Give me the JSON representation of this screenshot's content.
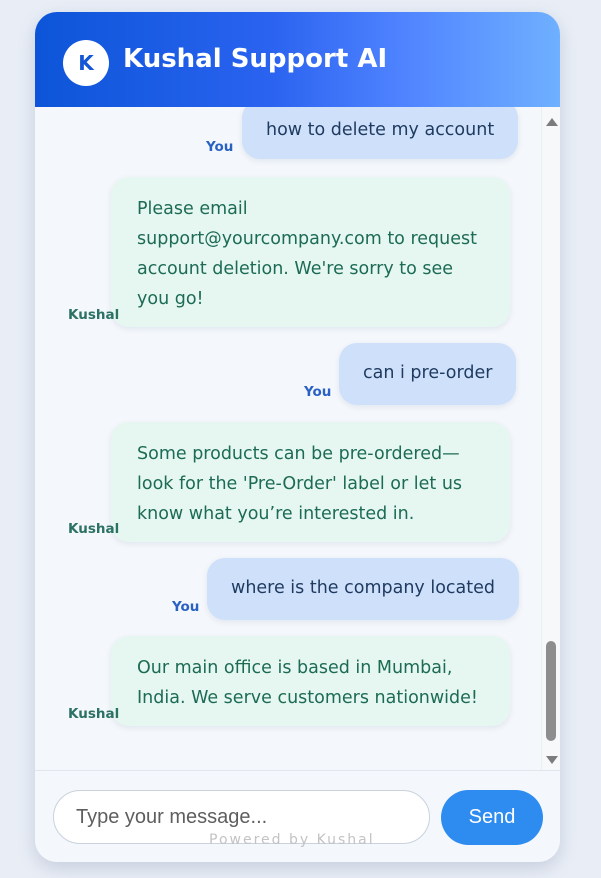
{
  "header": {
    "avatar_letter": "K",
    "title": "Kushal Support AI"
  },
  "messages": [
    {
      "role": "user",
      "sender": "You",
      "text": "how to delete my account"
    },
    {
      "role": "bot",
      "sender": "Kushal",
      "text": "Please email support@yourcompany.com to request account deletion. We're sorry to see you go!"
    },
    {
      "role": "user",
      "sender": "You",
      "text": "can i pre-order"
    },
    {
      "role": "bot",
      "sender": "Kushal",
      "text": "Some products can be pre-ordered—look for the 'Pre-Order' label or let us know what you’re interested in."
    },
    {
      "role": "user",
      "sender": "You",
      "text": "where is the company located"
    },
    {
      "role": "bot",
      "sender": "Kushal",
      "text": "Our main office is based in Mumbai, India. We serve customers nationwide!"
    }
  ],
  "composer": {
    "placeholder": "Type your message...",
    "value": "",
    "send_label": "Send"
  },
  "footer": {
    "powered_by": "Powered by Kushal"
  },
  "colors": {
    "header_start": "#0c55d8",
    "header_end": "#6fb0ff",
    "user_bubble": "#cfe0fb",
    "bot_bubble": "#e5f7f0",
    "bot_text": "#1d6b55",
    "send_button": "#2e8cf0"
  },
  "icons": {
    "scroll_up": "triangle-up-icon",
    "scroll_down": "triangle-down-icon"
  }
}
